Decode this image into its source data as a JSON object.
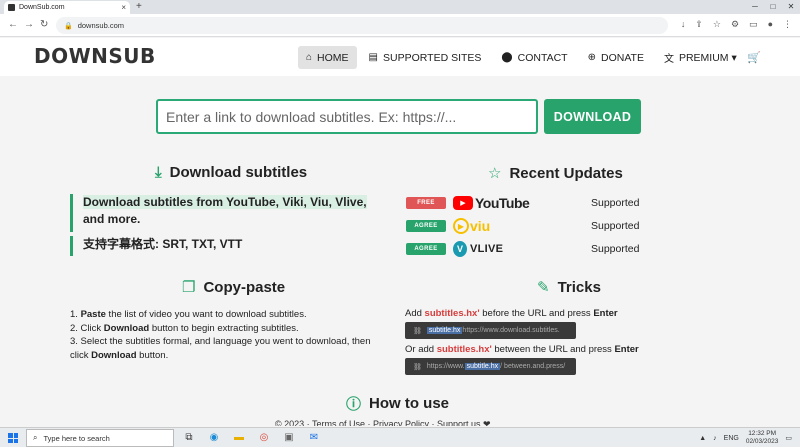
{
  "browser": {
    "tab_title": "DownSub.com",
    "tab_close": "×",
    "new_tab": "+",
    "url": "downsub.com",
    "window_controls": [
      "─",
      "□",
      "✕"
    ],
    "toolbar_icons": [
      "↓",
      "⇪",
      "☆",
      "⚙",
      "▭",
      "●",
      "⋮"
    ]
  },
  "site": {
    "logo": "DOWNSUB",
    "nav": [
      {
        "label": "HOME",
        "icon": "home-icon",
        "glyph": "⌂",
        "active": true
      },
      {
        "label": "SUPPORTED SITES",
        "icon": "list-card-icon",
        "glyph": "▤",
        "active": false
      },
      {
        "label": "CONTACT",
        "icon": "location-pin-icon",
        "glyph": "⬤",
        "active": false
      },
      {
        "label": "DONATE",
        "icon": "plus-circle-icon",
        "glyph": "⊕",
        "active": false
      },
      {
        "label": "PREMIUM ▾",
        "icon": "translate-icon",
        "glyph": "文",
        "active": false
      }
    ],
    "cart_glyph": "🛒"
  },
  "search": {
    "placeholder": "Enter a link to download subtitles. Ex: https://...",
    "button": "DOWNLOAD"
  },
  "download_section": {
    "title": "Download subtitles",
    "quote1_highlight": "Download subtitles from YouTube, Viki, Viu, Vlive,",
    "quote1_rest": "and more.",
    "quote2": "支持字幕格式: SRT, TXT, VTT"
  },
  "recent_updates": {
    "title": "Recent Updates",
    "items": [
      {
        "badge": "FREE",
        "brand": "YouTube",
        "status": "Supported"
      },
      {
        "badge": "AGREE",
        "brand": "viu",
        "status": "Supported"
      },
      {
        "badge": "AGREE",
        "brand": "VLIVE",
        "status": "Supported"
      }
    ]
  },
  "copy_paste": {
    "title": "Copy-paste",
    "step1_bold": "Paste",
    "step1_rest": " the list of video you want to download subtitles.",
    "step2_pre": "2. Click ",
    "step2_bold": "Download",
    "step2_rest": " button to begin extracting subtitles.",
    "step3_pre": "3. Select the subtitles formal, and language you went to download, then click ",
    "step3_bold": "Download",
    "step3_rest": " button."
  },
  "tricks": {
    "title": "Tricks",
    "line1_pre": "Add ",
    "line1_red": "subtitles.hx'",
    "line1_mid": " before the URL and press ",
    "line1_bold": "Enter",
    "code1_sel": "subtitle.hx",
    "code1_rest": " https://www.download.subtitles.",
    "line2_pre": "Or add ",
    "line2_red": "subtitles.hx'",
    "line2_mid": " between the URL and press ",
    "line2_bold": "Enter",
    "code2_pre": "https://www.",
    "code2_sel": "subtitle.hx",
    "code2_rest": "/ between.and.press/"
  },
  "how_to_use": {
    "title": "How to use"
  },
  "footer_peek": "© 2023  ·  Terms of Use  ·  Privacy Policy  ·  Support us ❤",
  "taskbar": {
    "search_placeholder": "Type here to search",
    "tray_lang": "ENG",
    "time": "12:32 PM",
    "date": "02/03/2023"
  }
}
